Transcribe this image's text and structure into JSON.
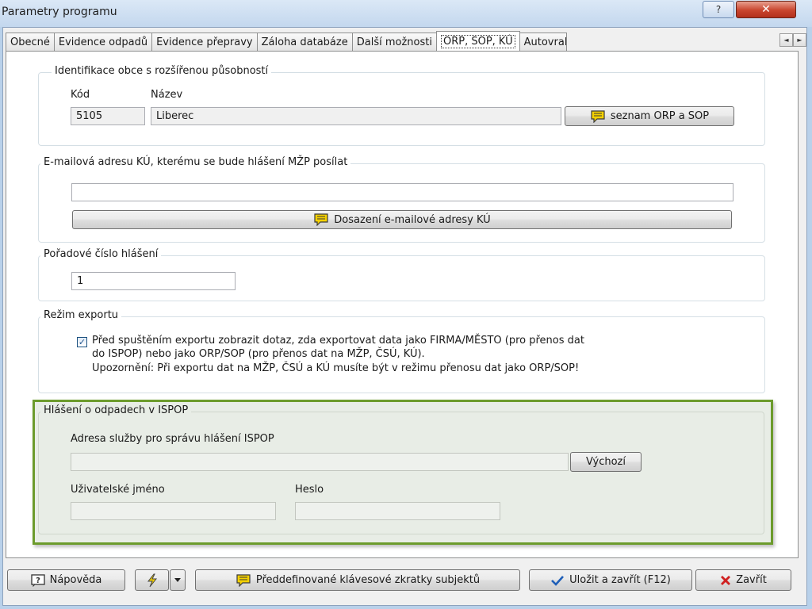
{
  "window": {
    "title": "Parametry programu",
    "help_glyph": "?",
    "close_glyph": "✕"
  },
  "tabs": [
    {
      "label": "Obecné"
    },
    {
      "label": "Evidence odpadů"
    },
    {
      "label": "Evidence přepravy"
    },
    {
      "label": "Záloha databáze"
    },
    {
      "label": "Další možnosti"
    },
    {
      "label": "ORP, SOP, KÚ",
      "active": true
    },
    {
      "label": "Autovraky"
    }
  ],
  "tab_scroll": {
    "left": "◄",
    "right": "►"
  },
  "orp_group": {
    "legend": "Identifikace obce s rozšířenou působností",
    "kod_label": "Kód",
    "nazev_label": "Název",
    "kod_value": "5105",
    "nazev_value": "Liberec",
    "list_button": "seznam ORP a SOP"
  },
  "email_group": {
    "legend": "E-mailová adresu KÚ, kterému se bude hlášení MŽP posílat",
    "email_value": "",
    "fill_button": "Dosazení e-mailové adresy KÚ"
  },
  "order_group": {
    "legend": "Pořadové číslo hlášení",
    "value": "1"
  },
  "export_group": {
    "legend": "Režim exportu",
    "checked": true,
    "line1": "Před spuštěním exportu zobrazit dotaz, zda exportovat data jako FIRMA/MĚSTO (pro přenos dat",
    "line2": "do ISPOP) nebo jako ORP/SOP (pro přenos dat na MŽP, ČSÚ, KÚ).",
    "line3": "Upozornění: Při exportu dat na MŽP, ČSÚ a KÚ musíte být v režimu přenosu dat jako ORP/SOP!"
  },
  "ispop_group": {
    "legend": "Hlášení o odpadech v ISPOP",
    "address_label": "Adresa služby pro správu hlášení ISPOP",
    "address_value": "",
    "default_button": "Výchozí",
    "user_label": "Uživatelské jméno",
    "user_value": "",
    "password_label": "Heslo",
    "password_value": ""
  },
  "bottom": {
    "help_button": "Nápověda",
    "shortcuts_button": "Předdefinované klávesové zkratky subjektů",
    "save_button": "Uložit a zavřít (F12)",
    "close_button": "Zavřít"
  },
  "colors": {
    "highlight_frame": "#6c9b2c",
    "title_bar": "#c3d7ee",
    "close_button": "#c9452e"
  },
  "icons": [
    "help-icon",
    "close-icon",
    "message-icon",
    "lightning-icon",
    "dropdown-arrow-icon",
    "checkmark-icon",
    "x-icon"
  ]
}
